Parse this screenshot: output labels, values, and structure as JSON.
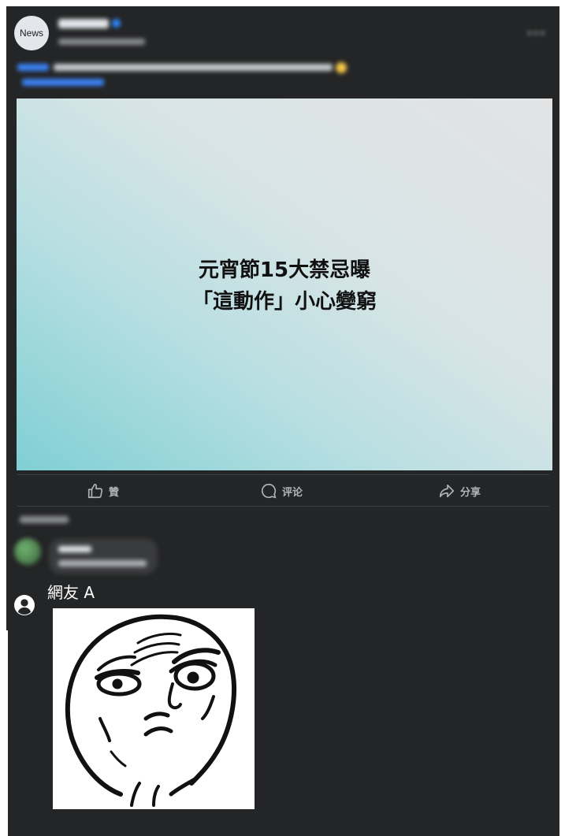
{
  "post": {
    "avatar_label": "News",
    "headline_line1": "元宵節15大禁忌曝",
    "headline_line2": "「這動作」小心變窮"
  },
  "actions": {
    "like_label": "贊",
    "comment_label": "评论",
    "share_label": "分享"
  },
  "comment": {
    "username": "網友 A"
  },
  "colors": {
    "background": "#242526",
    "text_secondary": "#b0b3b8",
    "accent": "#2d88ff"
  }
}
